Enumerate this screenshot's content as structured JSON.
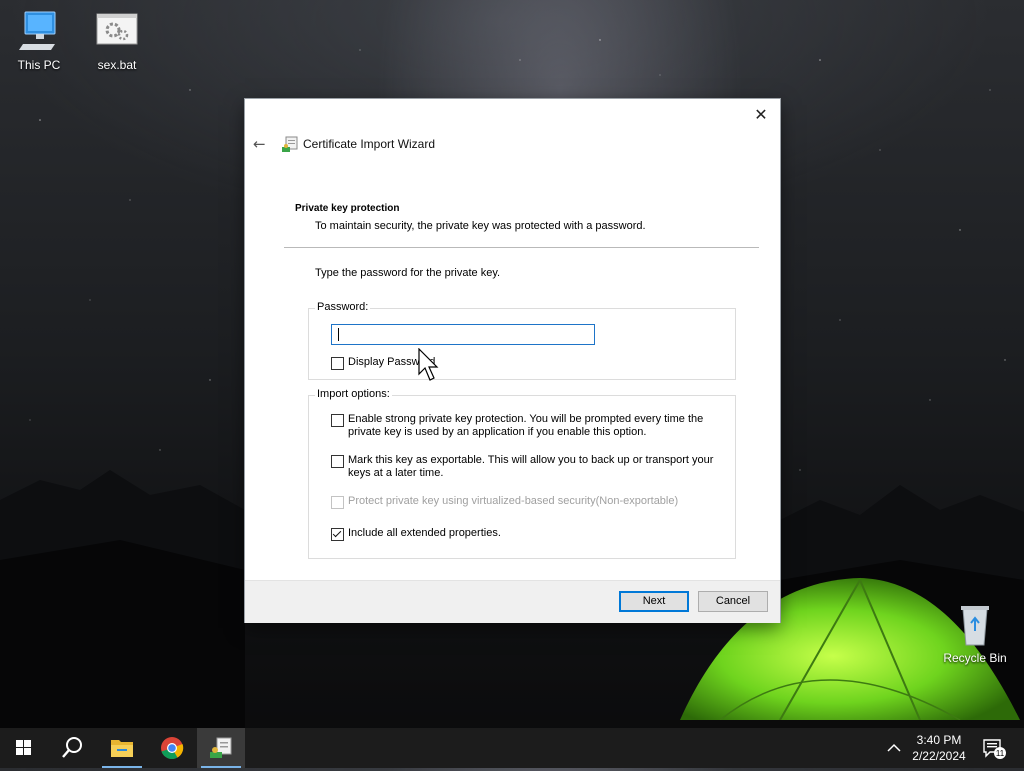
{
  "desktop": {
    "icons": [
      {
        "label": "This PC"
      },
      {
        "label": "sex.bat"
      },
      {
        "label": "Recycle Bin"
      }
    ]
  },
  "dialog": {
    "close_glyph": "✕",
    "back_glyph": "←",
    "title": "Certificate Import Wizard",
    "section_title": "Private key protection",
    "section_subtitle": "To maintain security, the private key was protected with a password.",
    "prompt": "Type the password for the private key.",
    "password_group_label": "Password:",
    "password_value": "",
    "display_password_label": "Display Password",
    "display_password_checked": false,
    "import_options_label": "Import options:",
    "options": [
      {
        "label": "Enable strong private key protection. You will be prompted every time the private key is used by an application if you enable this option.",
        "checked": false,
        "disabled": false
      },
      {
        "label": "Mark this key as exportable. This will allow you to back up or transport your keys at a later time.",
        "checked": false,
        "disabled": false
      },
      {
        "label": "Protect private key using virtualized-based security(Non-exportable)",
        "checked": false,
        "disabled": true
      },
      {
        "label": "Include all extended properties.",
        "checked": true,
        "disabled": false
      }
    ],
    "next_label": "Next",
    "cancel_label": "Cancel"
  },
  "taskbar": {
    "time": "3:40 PM",
    "date": "2/22/2024",
    "notification_count": "11",
    "tray_chevron": "^"
  },
  "colors": {
    "accent": "#0078d7",
    "taskbar": "#1c1c1c"
  }
}
